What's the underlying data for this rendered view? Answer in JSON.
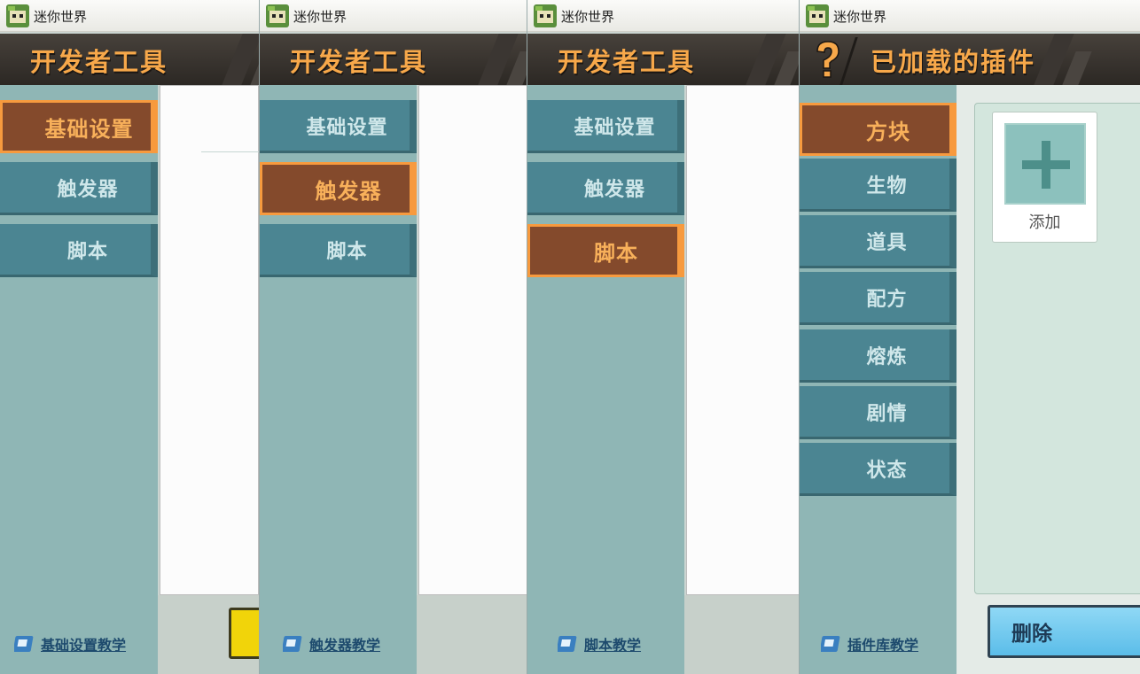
{
  "app_title": "迷你世界",
  "panels": [
    {
      "header_title": "开发者工具",
      "menu": [
        "基础设置",
        "触发器",
        "脚本"
      ],
      "selected": 0,
      "tutorial": "基础设置教学"
    },
    {
      "header_title": "开发者工具",
      "menu": [
        "基础设置",
        "触发器",
        "脚本"
      ],
      "selected": 1,
      "tutorial": "触发器教学"
    },
    {
      "header_title": "开发者工具",
      "menu": [
        "基础设置",
        "触发器",
        "脚本"
      ],
      "selected": 2,
      "tutorial": "脚本教学"
    },
    {
      "header_title": "已加载的插件",
      "menu": [
        "方块",
        "生物",
        "道具",
        "配方",
        "熔炼",
        "剧情",
        "状态"
      ],
      "selected": 0,
      "tutorial": "插件库教学",
      "add_label": "添加",
      "delete_label": "删除"
    }
  ],
  "colors": {
    "accent_orange": "#f79a3e",
    "selected_bg": "#844a2c",
    "menu_teal": "#4b8592",
    "sidebar_bg": "#8fb6b5"
  },
  "icons": [
    "app-icon",
    "help-icon",
    "book-icon",
    "plus-icon"
  ]
}
